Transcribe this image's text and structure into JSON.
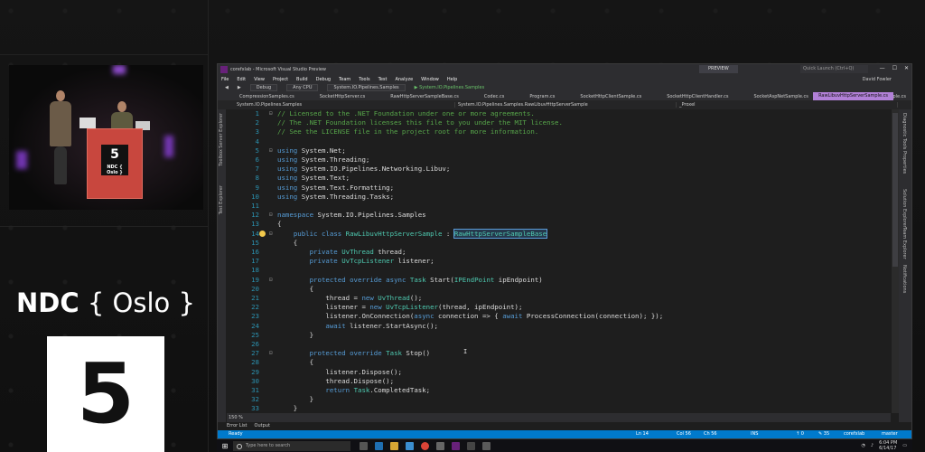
{
  "branding": {
    "ndc_word": "NDC",
    "oslo": "{ Oslo }",
    "room_number": "5",
    "podium_number": "5",
    "podium_label": "NDC { Oslo }"
  },
  "vs": {
    "title": "corefxlab - Microsoft Visual Studio Preview",
    "preview_label": "PREVIEW",
    "quick_launch_placeholder": "Quick Launch (Ctrl+Q)",
    "user": "David Fowler",
    "menu": [
      "File",
      "Edit",
      "View",
      "Project",
      "Build",
      "Debug",
      "Team",
      "Tools",
      "Test",
      "Analyze",
      "Window",
      "Help"
    ],
    "toolbar": {
      "config": "Debug",
      "platform": "Any CPU",
      "project": "System.IO.Pipelines.Samples",
      "run": "▶ System.IO.Pipelines.Samples"
    },
    "tabs": [
      "CompressionSamples.cs",
      "SocketHttpServer.cs",
      "RawHttpServerSampleBase.cs",
      "Codec.cs",
      "Program.cs",
      "SocketHttpClientSample.cs",
      "SocketHttpClientHandler.cs",
      "SocketAspNetSample.cs",
      "RawSocketHttpServerSample.cs"
    ],
    "active_tab": "RawLibuvHttpServerSample.cs",
    "nav": {
      "project": "System.IO.Pipelines.Samples",
      "type": "System.IO.Pipelines.Samples.RawLibuvHttpServerSample",
      "member": "_Proxel"
    },
    "left_tools": [
      "Server Explorer",
      "Toolbox",
      "Test Explorer"
    ],
    "right_tools": [
      "Diagnostic Tools",
      "Properties",
      "Solution Explorer",
      "Team Explorer",
      "Notifications"
    ],
    "zoom": "150 %",
    "bottom_tabs": [
      "Error List",
      "Output"
    ],
    "status": {
      "ready": "Ready",
      "ln": "Ln 14",
      "col": "Col 56",
      "ch": "Ch 56",
      "mode": "INS",
      "changes": "↑ 0",
      "pencil": "✎ 35",
      "repo": "corefxlab",
      "branch": "master"
    }
  },
  "code_lines": [
    {
      "n": "1",
      "fold": "⊟",
      "html": "<span class='c'>// Licensed to the .NET Foundation under one or more agreements.</span>"
    },
    {
      "n": "2",
      "fold": "",
      "html": "<span class='c'>// The .NET Foundation licenses this file to you under the MIT license.</span>"
    },
    {
      "n": "3",
      "fold": "",
      "html": "<span class='c'>// See the LICENSE file in the project root for more information.</span>"
    },
    {
      "n": "4",
      "fold": "",
      "html": ""
    },
    {
      "n": "5",
      "fold": "⊟",
      "html": "<span class='k'>using</span> System.Net;"
    },
    {
      "n": "6",
      "fold": "",
      "html": "<span class='k'>using</span> System.Threading;"
    },
    {
      "n": "7",
      "fold": "",
      "html": "<span class='k'>using</span> System.IO.Pipelines.Networking.Libuv;"
    },
    {
      "n": "8",
      "fold": "",
      "html": "<span class='k'>using</span> System.Text;"
    },
    {
      "n": "9",
      "fold": "",
      "html": "<span class='k'>using</span> System.Text.Formatting;"
    },
    {
      "n": "10",
      "fold": "",
      "html": "<span class='k'>using</span> System.Threading.Tasks;"
    },
    {
      "n": "11",
      "fold": "",
      "html": ""
    },
    {
      "n": "12",
      "fold": "⊟",
      "html": "<span class='k'>namespace</span> System.IO.Pipelines.Samples"
    },
    {
      "n": "13",
      "fold": "",
      "html": "{"
    },
    {
      "n": "14",
      "fold": "⊟",
      "html": "    <span class='k'>public</span> <span class='k'>class</span> <span class='t'>RawLibuvHttpServerSample</span> : <span class='t hl'>RawHttpServerSampleBase</span>"
    },
    {
      "n": "15",
      "fold": "",
      "html": "    {"
    },
    {
      "n": "16",
      "fold": "",
      "html": "        <span class='k'>private</span> <span class='t'>UvThread</span> thread;"
    },
    {
      "n": "17",
      "fold": "",
      "html": "        <span class='k'>private</span> <span class='t'>UvTcpListener</span> listener;"
    },
    {
      "n": "18",
      "fold": "",
      "html": ""
    },
    {
      "n": "19",
      "fold": "⊟",
      "html": "        <span class='k'>protected</span> <span class='k'>override</span> <span class='k'>async</span> <span class='t'>Task</span> Start(<span class='t'>IPEndPoint</span> ipEndpoint)"
    },
    {
      "n": "20",
      "fold": "",
      "html": "        {"
    },
    {
      "n": "21",
      "fold": "",
      "html": "            thread = <span class='k'>new</span> <span class='t'>UvThread</span>();"
    },
    {
      "n": "22",
      "fold": "",
      "html": "            listener = <span class='k'>new</span> <span class='t'>UvTcpListener</span>(thread, ipEndpoint);"
    },
    {
      "n": "23",
      "fold": "",
      "html": "            listener.OnConnection(<span class='k'>async</span> connection => { <span class='k'>await</span> ProcessConnection(connection); });"
    },
    {
      "n": "24",
      "fold": "",
      "html": "            <span class='k'>await</span> listener.StartAsync();"
    },
    {
      "n": "25",
      "fold": "",
      "html": "        }"
    },
    {
      "n": "26",
      "fold": "",
      "html": ""
    },
    {
      "n": "27",
      "fold": "⊟",
      "html": "        <span class='k'>protected</span> <span class='k'>override</span> <span class='t'>Task</span> Stop()"
    },
    {
      "n": "28",
      "fold": "",
      "html": "        {"
    },
    {
      "n": "29",
      "fold": "",
      "html": "            listener.Dispose();"
    },
    {
      "n": "30",
      "fold": "",
      "html": "            thread.Dispose();"
    },
    {
      "n": "31",
      "fold": "",
      "html": "            <span class='k'>return</span> <span class='t'>Task</span>.CompletedTask;"
    },
    {
      "n": "32",
      "fold": "",
      "html": "        }"
    },
    {
      "n": "33",
      "fold": "",
      "html": "    }"
    }
  ],
  "taskbar": {
    "search_placeholder": "Type here to search",
    "time": "6:04 PM",
    "date": "6/14/17"
  },
  "colors": {
    "status_blue": "#007acc",
    "active_tab": "#b180d7",
    "keyword": "#569cd6",
    "type": "#4ec9b0",
    "comment": "#57a64a",
    "line_number": "#2b91af"
  }
}
